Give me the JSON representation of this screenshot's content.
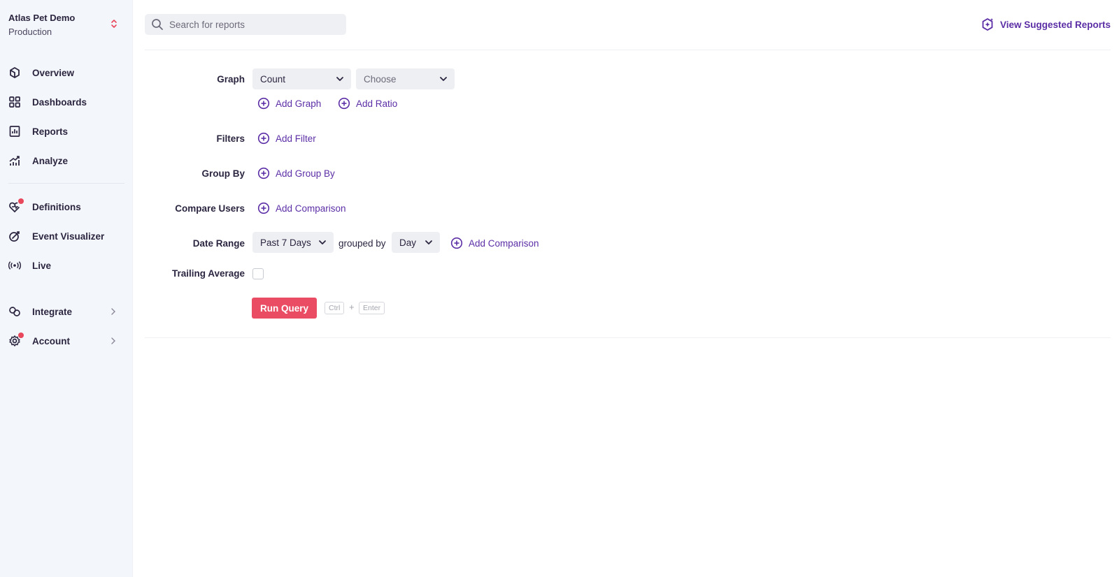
{
  "workspace": {
    "name": "Atlas Pet Demo",
    "environment": "Production"
  },
  "sidebar": {
    "items": [
      {
        "label": "Overview",
        "icon": "cube-icon"
      },
      {
        "label": "Dashboards",
        "icon": "grid-icon"
      },
      {
        "label": "Reports",
        "icon": "report-icon"
      },
      {
        "label": "Analyze",
        "icon": "chart-trend-icon"
      },
      {
        "label": "Definitions",
        "icon": "definitions-icon",
        "badge": true
      },
      {
        "label": "Event Visualizer",
        "icon": "visualizer-icon"
      },
      {
        "label": "Live",
        "icon": "broadcast-icon"
      },
      {
        "label": "Integrate",
        "icon": "link-icon",
        "expandable": true
      },
      {
        "label": "Account",
        "icon": "gear-icon",
        "badge": true,
        "expandable": true
      }
    ]
  },
  "search": {
    "placeholder": "Search for reports"
  },
  "suggested": {
    "label": "View Suggested Reports"
  },
  "form": {
    "graph": {
      "label": "Graph",
      "metric": "Count",
      "event_placeholder": "Choose",
      "add_graph": "Add Graph",
      "add_ratio": "Add Ratio"
    },
    "filters": {
      "label": "Filters",
      "add": "Add Filter"
    },
    "group_by": {
      "label": "Group By",
      "add": "Add Group By"
    },
    "compare_users": {
      "label": "Compare Users",
      "add": "Add Comparison"
    },
    "date_range": {
      "label": "Date Range",
      "value": "Past 7 Days",
      "grouped_by_text": "grouped by",
      "granularity": "Day",
      "add_comparison": "Add Comparison"
    },
    "trailing_average": {
      "label": "Trailing Average",
      "checked": false
    },
    "run": {
      "label": "Run Query",
      "shortcut_key1": "Ctrl",
      "shortcut_plus": "+",
      "shortcut_key2": "Enter"
    }
  },
  "colors": {
    "accent": "#5b2ea6",
    "primary_button": "#ea4c63",
    "badge": "#e8475c"
  }
}
